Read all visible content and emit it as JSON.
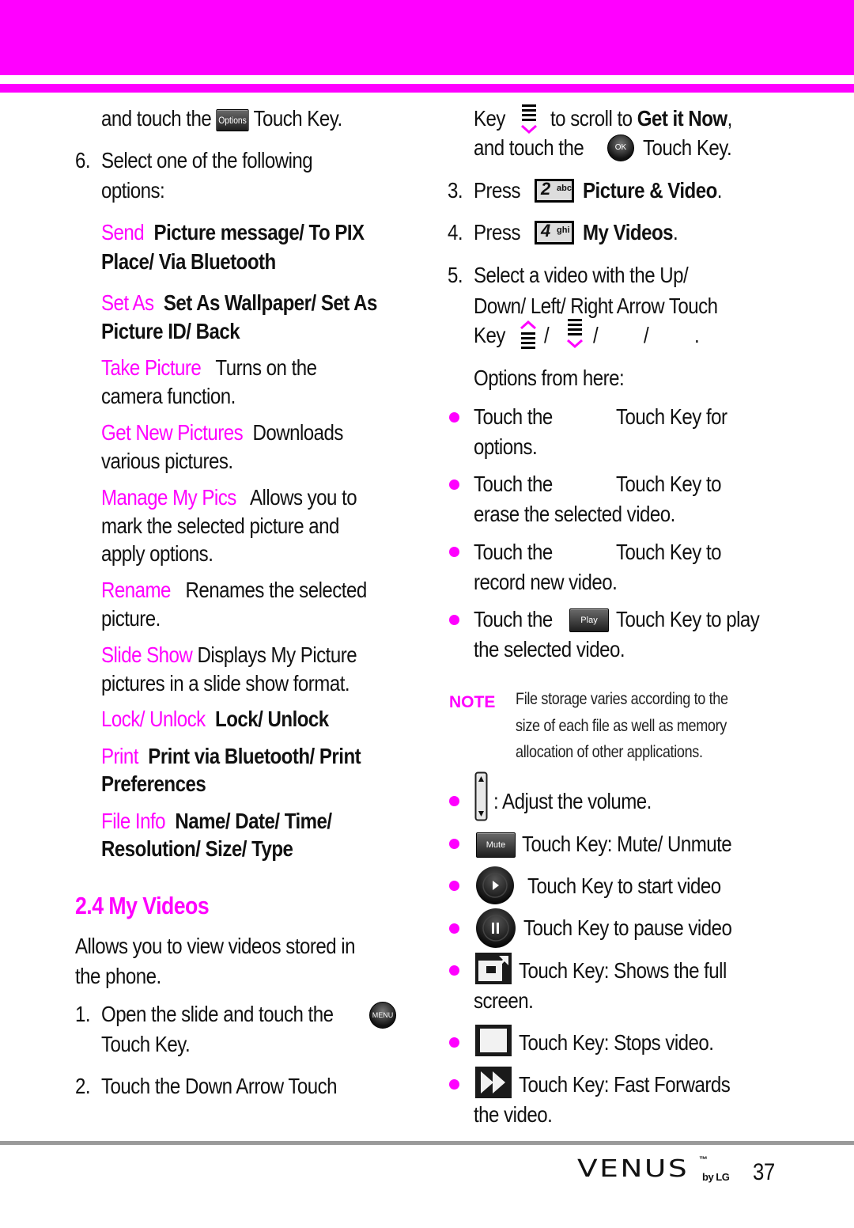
{
  "page": {
    "colors": {
      "accent": "#ff00ff",
      "text": "#111111",
      "rule": "#9a9a9a"
    }
  },
  "left": {
    "cont_line": {
      "pre": "and touch the",
      "icon_label": "Options",
      "post": "Touch Key."
    },
    "step6": {
      "num": "6.",
      "line1": "Select one of the following",
      "line2": "options:"
    },
    "options": [
      {
        "name": "Send",
        "desc_line1": "Picture message/ To PIX",
        "desc_line2": "Place/ Via Bluetooth",
        "bold": true
      },
      {
        "name": "Set As",
        "desc_line1": "Set As Wallpaper/ Set As",
        "desc_line2": "Picture ID/ Back",
        "bold": true
      },
      {
        "name": "Take Picture",
        "desc_line1": "Turns on the",
        "desc_line2": "camera function.",
        "bold": false
      },
      {
        "name": "Get New Pictures",
        "desc_line1": "Downloads",
        "desc_line2": "various pictures.",
        "bold": false
      },
      {
        "name": "Manage My Pics",
        "desc_line1": "Allows you to",
        "desc_line2": "mark the selected picture and",
        "desc_line3": "apply options.",
        "bold": false
      },
      {
        "name": "Rename",
        "desc_line1": "Renames the selected",
        "desc_line2": "picture.",
        "bold": false
      },
      {
        "name": "Slide Show",
        "desc_line1": "Displays My Picture",
        "desc_line2": "pictures in a slide show format.",
        "bold": false
      },
      {
        "name": "Lock/ Unlock",
        "desc_line1": "Lock/ Unlock",
        "bold": true
      },
      {
        "name": "Print",
        "desc_line1": "Print via Bluetooth/ Print",
        "desc_line2": "Preferences",
        "bold": true
      },
      {
        "name": "File Info",
        "desc_line1": "Name/ Date/ Time/",
        "desc_line2": "Resolution/ Size/ Type",
        "bold": true
      }
    ],
    "section": {
      "title": "2.4 My Videos",
      "intro_line1": "Allows you to view videos stored in",
      "intro_line2": "the phone.",
      "step1": {
        "num": "1.",
        "line1": "Open the slide and touch the",
        "icon_label": "MENU",
        "line2": "Touch Key."
      },
      "step2": {
        "num": "2.",
        "line1": "Touch the Down Arrow Touch"
      }
    }
  },
  "right": {
    "step2_cont": {
      "line1_pre": "Key",
      "line1_post": "to scroll to",
      "line1_bold": "Get it Now",
      "line1_end": ",",
      "line2_pre": "and touch the",
      "icon_label": "OK",
      "line2_post": "Touch Key."
    },
    "step3": {
      "num": "3.",
      "pre": "Press",
      "key_digit": "2",
      "key_letters": "abc",
      "bold": "Picture & Video",
      "end": "."
    },
    "step4": {
      "num": "4.",
      "pre": "Press",
      "key_digit": "4",
      "key_letters": "ghi",
      "bold": "My Videos",
      "end": "."
    },
    "step5": {
      "num": "5.",
      "line1": "Select a video with the Up/",
      "line2": "Down/ Left/ Right Arrow Touch",
      "line3_pre": "Key",
      "sep": "/",
      "end": ".",
      "line4": "Options from here:"
    },
    "bullets": [
      {
        "line1_pre": "Touch the",
        "line1_post": "Touch Key for",
        "line2": "options."
      },
      {
        "line1_pre": "Touch the",
        "line1_post": "Touch Key to",
        "line2": "erase the selected video."
      },
      {
        "line1_pre": "Touch the",
        "line1_post": "Touch Key to",
        "line2": "record new video."
      },
      {
        "line1_pre": "Touch the",
        "icon_label": "Play",
        "line1_post": "Touch Key to play",
        "line2": "the selected video."
      }
    ],
    "note": {
      "label": "NOTE",
      "line1": "File storage varies according to the",
      "line2": "size of each file as well as memory",
      "line3": "allocation of other applications."
    },
    "controls": [
      {
        "icon": "volume-rocker-icon",
        "text": ": Adjust the volume."
      },
      {
        "icon": "mute-key-icon",
        "icon_label": "Mute",
        "text": "Touch Key: Mute/ Unmute"
      },
      {
        "icon": "play-circle-icon",
        "text": "Touch Key to start video"
      },
      {
        "icon": "pause-circle-icon",
        "text": "Touch Key to pause video"
      },
      {
        "icon": "fullscreen-icon",
        "text": "Touch Key: Shows the full",
        "text2": "screen."
      },
      {
        "icon": "stop-icon",
        "text": "Touch Key: Stops video."
      },
      {
        "icon": "fast-forward-icon",
        "text": "Touch Key: Fast Forwards",
        "text2": "the video."
      }
    ]
  },
  "footer": {
    "brand": "VENUS",
    "brand_tm": "™",
    "brand_sub": "by LG",
    "page_number": "37"
  }
}
